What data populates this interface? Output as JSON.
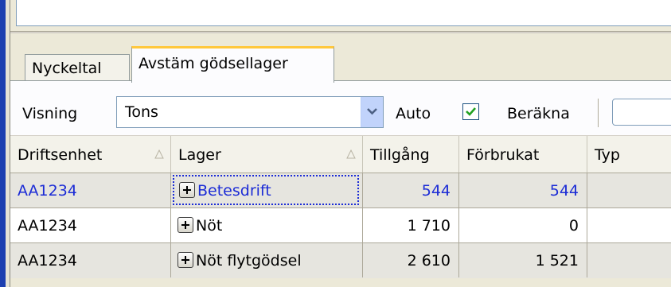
{
  "tabs": [
    {
      "label": "Nyckeltal",
      "active": false
    },
    {
      "label": "Avstäm gödsellager",
      "active": true
    }
  ],
  "toolbar": {
    "visning_label": "Visning",
    "visning_value": "Tons",
    "auto_label": "Auto",
    "auto_checked": true,
    "berakna_label": "Beräkna"
  },
  "grid": {
    "columns": [
      "Driftsenhet",
      "Lager",
      "Tillgång",
      "Förbrukat",
      "Typ"
    ],
    "rows": [
      {
        "driftsenhet": "AA1234",
        "lager": "Betesdrift",
        "tillgang": "544",
        "forbrukat": "544",
        "typ": "",
        "selected": true
      },
      {
        "driftsenhet": "AA1234",
        "lager": "Nöt",
        "tillgang": "1 710",
        "forbrukat": "0",
        "typ": "",
        "selected": false
      },
      {
        "driftsenhet": "AA1234",
        "lager": "Nöt flytgödsel",
        "tillgang": "2 610",
        "forbrukat": "1 521",
        "typ": "",
        "selected": false
      }
    ]
  },
  "colors": {
    "selected_text": "#1c2cd6",
    "tab_accent": "#ffc83c",
    "checkbox_check": "#21a121"
  }
}
